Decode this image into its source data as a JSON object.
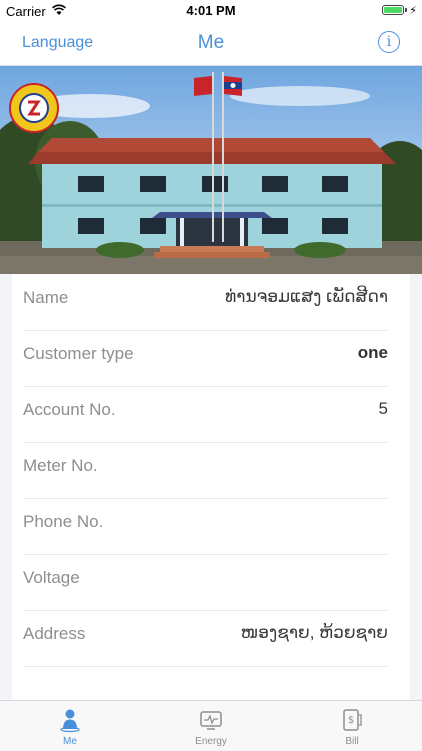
{
  "status_bar": {
    "carrier": "Carrier",
    "time": "4:01 PM"
  },
  "nav": {
    "language_label": "Language",
    "title": "Me"
  },
  "profile_rows": [
    {
      "label": "Name",
      "value": "ທ່ານຈອມແສງ ເພັດສີດາ"
    },
    {
      "label": "Customer type",
      "value": "one"
    },
    {
      "label": "Account No.",
      "value": "5"
    },
    {
      "label": "Meter No.",
      "value": ""
    },
    {
      "label": "Phone No.",
      "value": ""
    },
    {
      "label": "Voltage",
      "value": ""
    },
    {
      "label": "Address",
      "value": "ໜອງຊາຍ, ຫ້ວຍຊາຍ"
    }
  ],
  "tabs": [
    {
      "label": "Me",
      "icon": "person-icon",
      "active": true
    },
    {
      "label": "Energy",
      "icon": "monitor-icon",
      "active": false
    },
    {
      "label": "Bill",
      "icon": "bill-icon",
      "active": false
    }
  ],
  "colors": {
    "accent": "#4a90d9",
    "label_gray": "#8e8e93",
    "battery": "#4cd964"
  }
}
